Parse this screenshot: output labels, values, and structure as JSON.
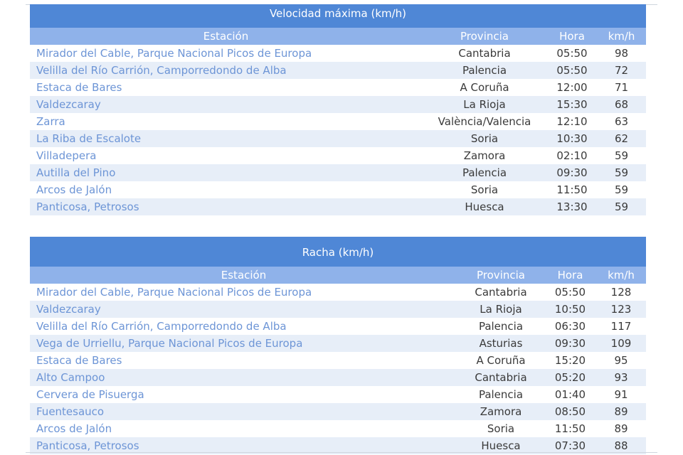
{
  "max_speed": {
    "title": "Velocidad máxima (km/h)",
    "columns": [
      "Estación",
      "Provincia",
      "Hora",
      "km/h"
    ],
    "rows": [
      [
        "Mirador del Cable, Parque Nacional Picos de Europa",
        "Cantabria",
        "05:50",
        "98"
      ],
      [
        "Velilla del Río Carrión, Camporredondo de Alba",
        "Palencia",
        "05:50",
        "72"
      ],
      [
        "Estaca de Bares",
        "A Coruña",
        "12:00",
        "71"
      ],
      [
        "Valdezcaray",
        "La Rioja",
        "15:30",
        "68"
      ],
      [
        "Zarra",
        "València/Valencia",
        "12:10",
        "63"
      ],
      [
        "La Riba de Escalote",
        "Soria",
        "10:30",
        "62"
      ],
      [
        "Villadepera",
        "Zamora",
        "02:10",
        "59"
      ],
      [
        "Autilla del Pino",
        "Palencia",
        "09:30",
        "59"
      ],
      [
        "Arcos de Jalón",
        "Soria",
        "11:50",
        "59"
      ],
      [
        "Panticosa, Petrosos",
        "Huesca",
        "13:30",
        "59"
      ]
    ]
  },
  "gust": {
    "title": "Racha (km/h)",
    "columns": [
      "Estación",
      "Provincia",
      "Hora",
      "km/h"
    ],
    "rows": [
      [
        "Mirador del Cable, Parque Nacional Picos de Europa",
        "Cantabria",
        "05:50",
        "128"
      ],
      [
        "Valdezcaray",
        "La Rioja",
        "10:50",
        "123"
      ],
      [
        "Velilla del Río Carrión, Camporredondo de Alba",
        "Palencia",
        "06:30",
        "117"
      ],
      [
        "Vega de Urriellu, Parque Nacional Picos de Europa",
        "Asturias",
        "09:30",
        "109"
      ],
      [
        "Estaca de Bares",
        "A Coruña",
        "15:20",
        "95"
      ],
      [
        "Alto Campoo",
        "Cantabria",
        "05:20",
        "93"
      ],
      [
        "Cervera de Pisuerga",
        "Palencia",
        "01:40",
        "91"
      ],
      [
        "Fuentesauco",
        "Zamora",
        "08:50",
        "89"
      ],
      [
        "Arcos de Jalón",
        "Soria",
        "11:50",
        "89"
      ],
      [
        "Panticosa, Petrosos",
        "Huesca",
        "07:30",
        "88"
      ]
    ]
  }
}
